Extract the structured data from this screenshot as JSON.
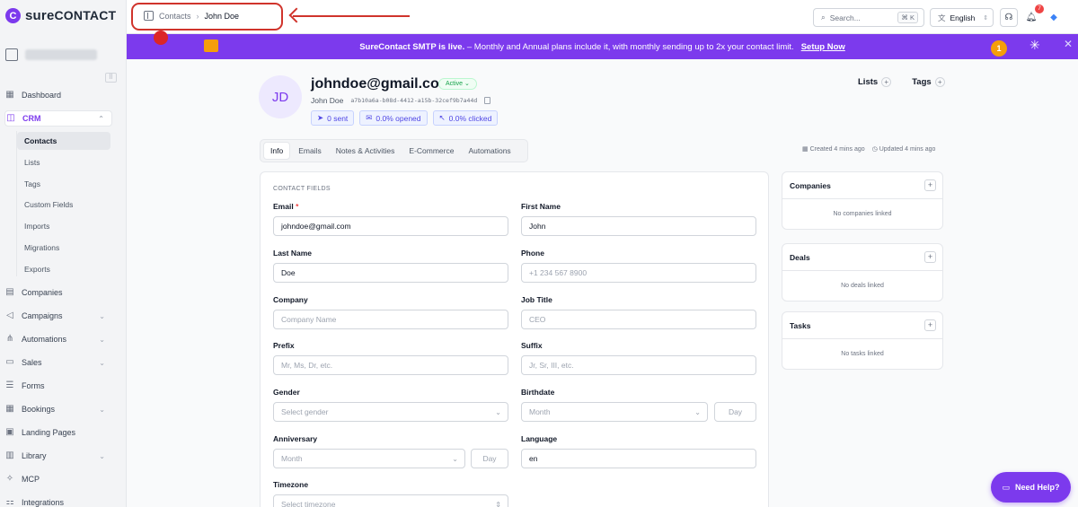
{
  "brand": {
    "logo_letter": "C",
    "name_a": "sure",
    "name_b": "CONTACT"
  },
  "sidebar": {
    "items": [
      {
        "label": "Dashboard",
        "icon": "grid-icon"
      },
      {
        "label": "CRM",
        "icon": "crm-icon"
      },
      {
        "label": "Companies",
        "icon": "building-icon"
      },
      {
        "label": "Campaigns",
        "icon": "megaphone-icon"
      },
      {
        "label": "Automations",
        "icon": "flow-icon"
      },
      {
        "label": "Sales",
        "icon": "briefcase-icon"
      },
      {
        "label": "Forms",
        "icon": "form-icon"
      },
      {
        "label": "Bookings",
        "icon": "calendar-icon"
      },
      {
        "label": "Landing Pages",
        "icon": "page-icon"
      },
      {
        "label": "Library",
        "icon": "library-icon"
      },
      {
        "label": "MCP",
        "icon": "mcp-icon"
      },
      {
        "label": "Integrations",
        "icon": "plug-icon"
      }
    ],
    "crm_sub": [
      "Contacts",
      "Lists",
      "Tags",
      "Custom Fields",
      "Imports",
      "Migrations",
      "Exports"
    ]
  },
  "topbar": {
    "crumb_parent": "Contacts",
    "crumb_current": "John Doe",
    "search_placeholder": "Search...",
    "search_kbd": "⌘ K",
    "language": "English",
    "notif_count": "7"
  },
  "banner": {
    "bold": "SureContact SMTP is live.",
    "text": " – Monthly and Annual plans include it, with monthly sending up to 2x your contact limit.",
    "link": "Setup Now",
    "medal_number": "1"
  },
  "contact": {
    "initials": "JD",
    "email": "johndoe@gmail.com",
    "status": "Active",
    "name": "John Doe",
    "id": "a7b10a6a-b08d-4412-a15b-32cef9b7a44d",
    "stats": {
      "sent": "0 sent",
      "opened": "0.0% opened",
      "clicked": "0.0% clicked"
    }
  },
  "header_actions": {
    "lists": "Lists",
    "tags": "Tags",
    "plus": "+"
  },
  "tabs": [
    "Info",
    "Emails",
    "Notes & Activities",
    "E-Commerce",
    "Automations"
  ],
  "meta": {
    "created": "Created 4 mins ago",
    "updated": "Updated 4 mins ago"
  },
  "form": {
    "section": "CONTACT FIELDS",
    "email": {
      "label": "Email",
      "required_mark": "*",
      "value": "johndoe@gmail.com"
    },
    "first_name": {
      "label": "First Name",
      "value": "John"
    },
    "last_name": {
      "label": "Last Name",
      "value": "Doe"
    },
    "phone": {
      "label": "Phone",
      "placeholder": "+1 234 567 8900"
    },
    "company": {
      "label": "Company",
      "placeholder": "Company Name"
    },
    "job_title": {
      "label": "Job Title",
      "placeholder": "CEO"
    },
    "prefix": {
      "label": "Prefix",
      "placeholder": "Mr, Ms, Dr, etc."
    },
    "suffix": {
      "label": "Suffix",
      "placeholder": "Jr, Sr, III, etc."
    },
    "gender": {
      "label": "Gender",
      "placeholder": "Select gender"
    },
    "birthdate": {
      "label": "Birthdate",
      "month": "Month",
      "day": "Day"
    },
    "anniversary": {
      "label": "Anniversary",
      "month": "Month",
      "day": "Day"
    },
    "language": {
      "label": "Language",
      "value": "en"
    },
    "timezone": {
      "label": "Timezone",
      "placeholder": "Select timezone"
    }
  },
  "side_cards": [
    {
      "title": "Companies",
      "empty": "No companies linked"
    },
    {
      "title": "Deals",
      "empty": "No deals linked"
    },
    {
      "title": "Tasks",
      "empty": "No tasks linked"
    }
  ],
  "help": {
    "label": "Need Help?"
  },
  "colors": {
    "accent": "#7c3aed",
    "annotation": "#d0342c",
    "active_green": "#16a34a"
  }
}
